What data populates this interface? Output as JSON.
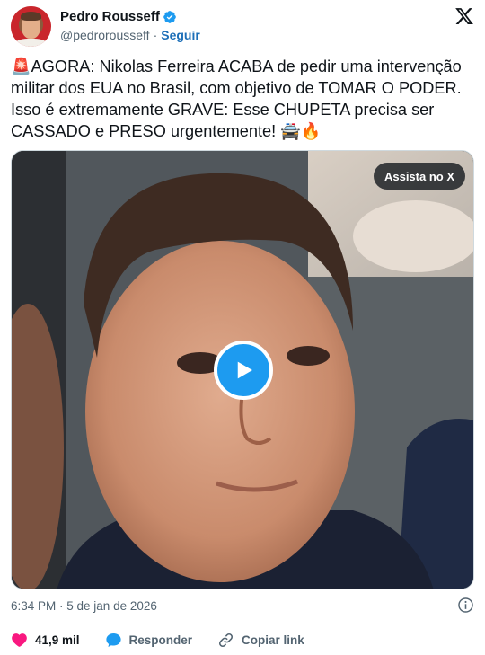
{
  "author": {
    "name": "Pedro Rousseff",
    "handle": "@pedrorousseff",
    "separator": "·",
    "follow_label": "Seguir"
  },
  "tweet": {
    "text": "🚨AGORA: Nikolas Ferreira ACABA de pedir uma intervenção militar dos EUA no Brasil, com objetivo de TOMAR O PODER. Isso é extremamente GRAVE: Esse CHUPETA precisa ser CASSADO e PRESO urgentemente! 🚔🔥"
  },
  "media": {
    "watch_label": "Assista no X"
  },
  "meta": {
    "timestamp": "6:34 PM · 5 de jan de 2026"
  },
  "actions": {
    "likes": "41,9 mil",
    "reply_label": "Responder",
    "copy_link_label": "Copiar link"
  },
  "colors": {
    "accent": "#1d9bf0",
    "like": "#f91880",
    "text": "#0f1419",
    "muted": "#536471"
  },
  "icons": {
    "brand": "x-logo-icon",
    "verified": "verified-badge-icon",
    "play": "play-icon",
    "info": "info-icon",
    "like": "heart-icon",
    "reply": "reply-bubble-icon",
    "link": "link-icon"
  }
}
